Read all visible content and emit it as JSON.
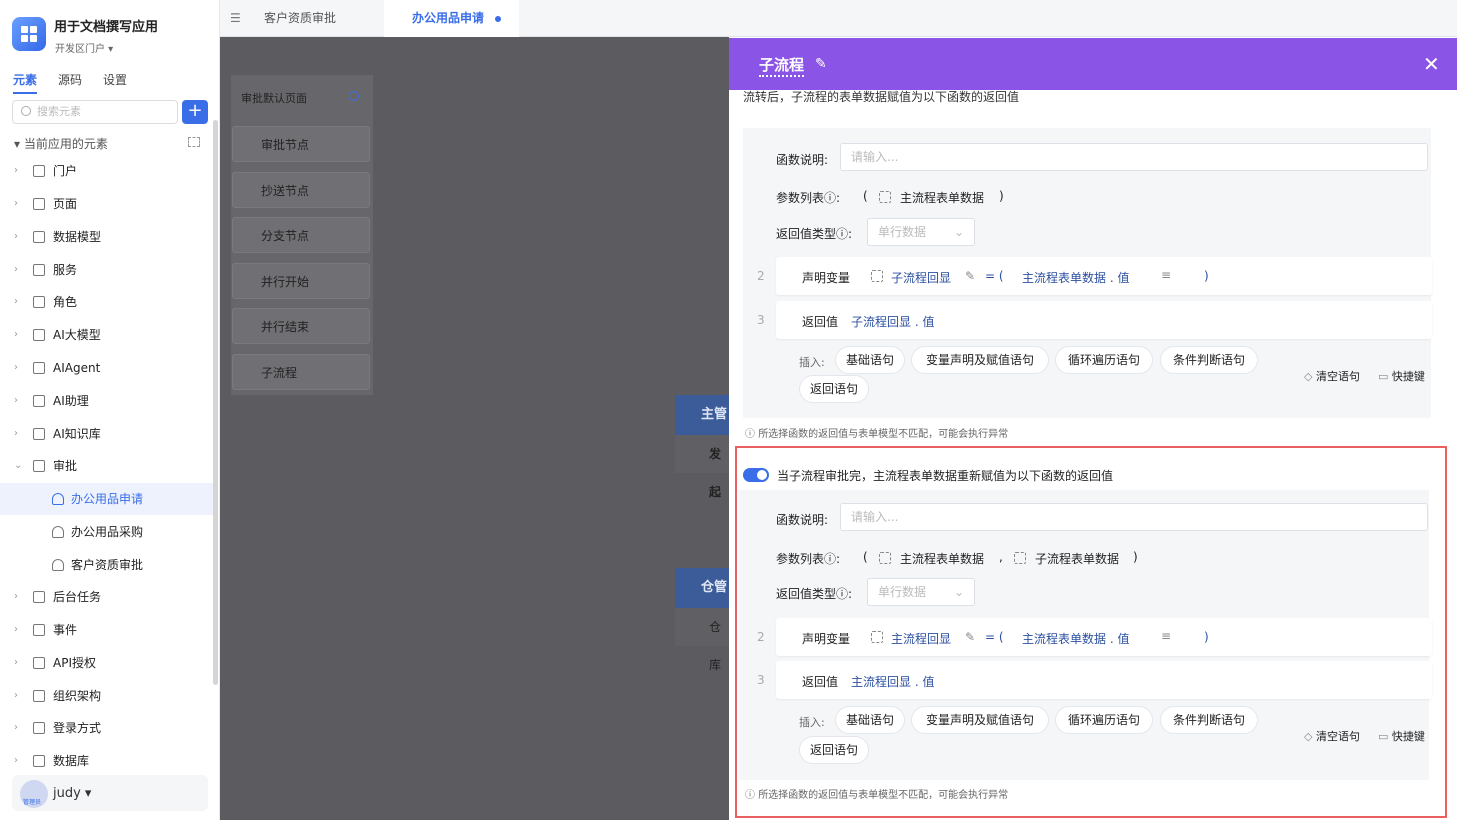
{
  "app": {
    "title": "用于文档撰写应用",
    "subtitle": "开发区门户 ▾"
  },
  "side_tabs": [
    "元素",
    "源码",
    "设置"
  ],
  "search": {
    "placeholder": "搜索元素"
  },
  "tree": {
    "header": "当前应用的元素",
    "items": [
      "门户",
      "页面",
      "数据模型",
      "服务",
      "角色",
      "AI大模型",
      "AIAgent",
      "AI助理",
      "AI知识库",
      "审批",
      "办公用品申请",
      "办公用品采购",
      "客户资质审批",
      "后台任务",
      "事件",
      "API授权",
      "组织架构",
      "登录方式",
      "数据库"
    ]
  },
  "user": {
    "name": "judy ▾",
    "role": "管理员"
  },
  "top_tabs": [
    "客户资质审批",
    "办公用品申请"
  ],
  "canvas": {
    "page_title": "审批默认页面",
    "nodes": [
      "审批节点",
      "抄送节点",
      "分支节点",
      "并行开始",
      "并行结束",
      "子流程"
    ],
    "flow_nodes": [
      "主管",
      "发起",
      "仓管",
      "仓库"
    ]
  },
  "drawer": {
    "title": "子流程",
    "close": "✕",
    "cut_text": "流转后，子流程的表单数据赋值为以下函数的返回值",
    "func_desc_label": "函数说明:",
    "func_desc_placeholder": "请输入...",
    "params_label": "参数列表",
    "return_type_label": "返回值类型",
    "return_type_value": "单行数据",
    "declare": "声明变量",
    "return_kw": "返回值",
    "insert_label": "插入:",
    "insert_buttons": [
      "基础语句",
      "变量声明及赋值语句",
      "循环遍历语句",
      "条件判断语句",
      "返回语句"
    ],
    "clear": "清空语句",
    "shortcut": "快捷键",
    "warning": "所选择函数的返回值与表单模型不匹配，可能会执行异常",
    "section1": {
      "param1": "主流程表单数据",
      "var": "子流程回显",
      "expr": "主流程表单数据 . 值",
      "return_val": "子流程回显 . 值"
    },
    "section2": {
      "toggle_text": "当子流程审批完，主流程表单数据重新赋值为以下函数的返回值",
      "param1": "主流程表单数据",
      "param2": "子流程表单数据",
      "var": "主流程回显",
      "expr": "主流程表单数据 . 值",
      "return_val": "主流程回显 . 值"
    }
  }
}
